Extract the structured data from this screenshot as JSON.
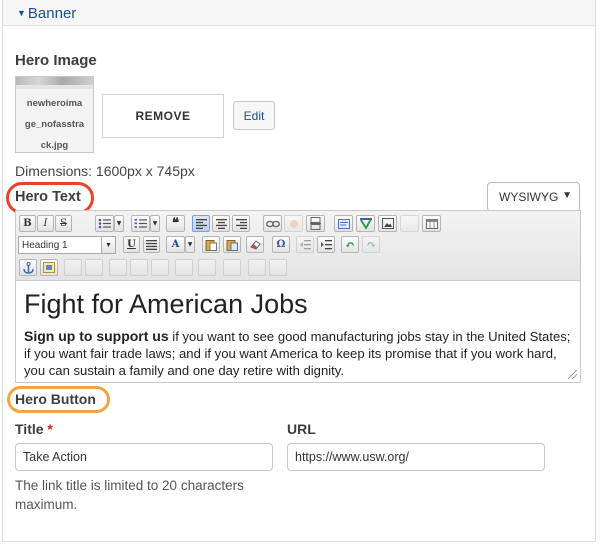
{
  "banner": {
    "label": "Banner"
  },
  "hero_image": {
    "label": "Hero Image",
    "thumbnail_lines": [
      "newheroima",
      "ge_nofasstra",
      "ck.jpg"
    ],
    "remove_label": "REMOVE",
    "edit_label": "Edit",
    "dimensions": "Dimensions: 1600px x 745px"
  },
  "hero_text": {
    "label": "Hero Text",
    "format": "WYSIWYG",
    "heading_format": "Heading 1",
    "content": {
      "heading": "Fight for American Jobs",
      "lead": "Sign up to support us",
      "body": " if you want to see good manufacturing jobs stay in the United States; if you want fair trade laws; and if you want America to keep its promise that if you work hard, you can sustain a family and one day retire with dignity."
    }
  },
  "hero_button": {
    "label": "Hero Button",
    "title_label": "Title",
    "required_mark": "*",
    "title_value": "Take Action",
    "url_label": "URL",
    "url_value": "https://www.usw.org/",
    "help": "The link title is limited to 20 characters maximum."
  },
  "annotations": {
    "hero_text_circle": "#e8432c",
    "hero_button_circle": "#f3a540"
  },
  "colors": {
    "link": "#1c4f8e",
    "required": "#d42020"
  }
}
